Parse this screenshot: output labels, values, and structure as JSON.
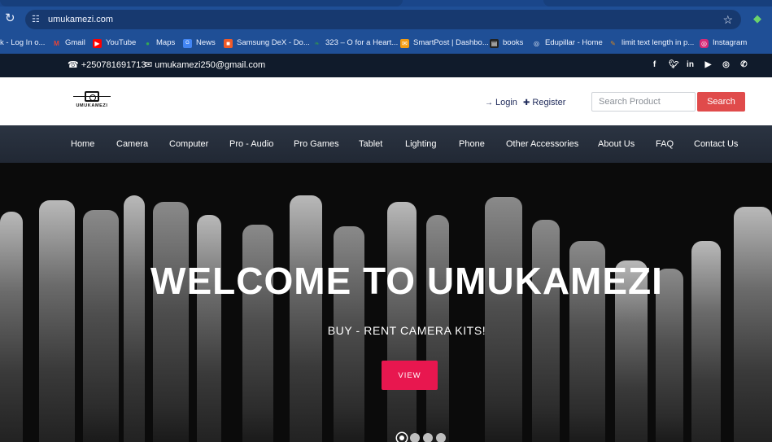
{
  "browser": {
    "url": "umukamezi.com",
    "bookmarks": [
      {
        "label": "k - Log In o...",
        "icon": "page-icon",
        "color": "#5a7bd8"
      },
      {
        "label": "Gmail",
        "icon": "gmail-icon",
        "color": "#ea4335"
      },
      {
        "label": "YouTube",
        "icon": "youtube-icon",
        "color": "#ff0000"
      },
      {
        "label": "Maps",
        "icon": "maps-icon",
        "color": "#34a853"
      },
      {
        "label": "News",
        "icon": "news-icon",
        "color": "#4285f4"
      },
      {
        "label": "Samsung DeX - Do...",
        "icon": "samsung-icon",
        "color": "#f05a28"
      },
      {
        "label": "323 – O for a Heart...",
        "icon": "leaf-icon",
        "color": "#2e8b57"
      },
      {
        "label": "SmartPost | Dashbo...",
        "icon": "smartpost-icon",
        "color": "#f39c12"
      },
      {
        "label": "books",
        "icon": "books-icon",
        "color": "#222222"
      },
      {
        "label": "Edupillar - Home",
        "icon": "globe-icon",
        "color": "#cfd8ea"
      },
      {
        "label": "limit text length in p...",
        "icon": "pen-icon",
        "color": "#d6851f"
      },
      {
        "label": "Instagram",
        "icon": "instagram-icon",
        "color": "#d62976"
      }
    ]
  },
  "topbar": {
    "phone": "+250781691713",
    "email": "umukamezi250@gmail.com",
    "socials": [
      "facebook-icon",
      "twitter-icon",
      "linkedin-icon",
      "youtube-icon",
      "instagram-icon",
      "whatsapp-icon"
    ]
  },
  "header": {
    "logo_text": "UMUKAMEZI",
    "login_label": "Login",
    "register_label": "Register",
    "search_placeholder": "Search Product",
    "search_button": "Search"
  },
  "nav": {
    "items": [
      "Home",
      "Camera",
      "Computer",
      "Pro - Audio",
      "Pro Games",
      "Tablet",
      "Lighting",
      "Phone",
      "Other Accessories",
      "About Us",
      "FAQ",
      "Contact Us"
    ]
  },
  "hero": {
    "title": "WELCOME TO UMUKAMEZI",
    "subtitle": "BUY - RENT CAMERA KITS!",
    "button_label": "VIEW",
    "slides": 4,
    "active_slide": 1
  },
  "colors": {
    "accent": "#e8174f",
    "search_button": "#e04b4b",
    "topbar": "#101b2b",
    "nav": "#252d3a"
  }
}
